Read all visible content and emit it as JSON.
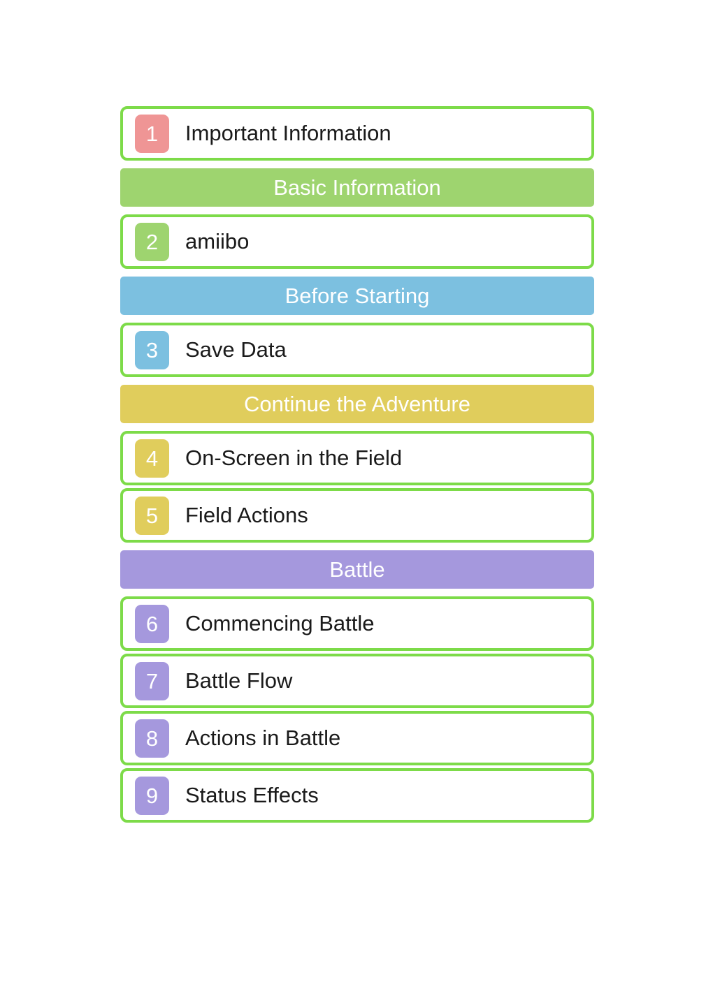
{
  "page": {
    "background_color": "#ffffff",
    "card_border_color": "#7ddb49",
    "card_background_color": "#ffffff",
    "title_text_color": "#1a1a1a",
    "header_text_color": "#ffffff"
  },
  "palette": {
    "important": "#ef9595",
    "basic": "#9ed46f",
    "before_starting": "#7cc0e0",
    "continue_adventure": "#e0cd5c",
    "battle": "#a598dd",
    "card_border": "#7ddb49"
  },
  "toc": {
    "entries": [
      {
        "kind": "chapter",
        "number": "1",
        "label": "Important Information",
        "badge_color": "#ef9595",
        "name": "toc-entry-important-information"
      },
      {
        "kind": "section",
        "label": "Basic Information",
        "bar_color": "#9ed46f",
        "name": "toc-section-basic-information"
      },
      {
        "kind": "chapter",
        "number": "2",
        "label": "amiibo",
        "badge_color": "#9ed46f",
        "name": "toc-entry-amiibo"
      },
      {
        "kind": "section",
        "label": "Before Starting",
        "bar_color": "#7cc0e0",
        "name": "toc-section-before-starting"
      },
      {
        "kind": "chapter",
        "number": "3",
        "label": "Save Data",
        "badge_color": "#7cc0e0",
        "name": "toc-entry-save-data"
      },
      {
        "kind": "section",
        "label": "Continue the Adventure",
        "bar_color": "#e0cd5c",
        "name": "toc-section-continue-the-adventure"
      },
      {
        "kind": "chapter",
        "number": "4",
        "label": "On-Screen in the Field",
        "badge_color": "#e0cd5c",
        "name": "toc-entry-on-screen-in-the-field"
      },
      {
        "kind": "chapter",
        "number": "5",
        "label": "Field Actions",
        "badge_color": "#e0cd5c",
        "name": "toc-entry-field-actions"
      },
      {
        "kind": "section",
        "label": "Battle",
        "bar_color": "#a598dd",
        "name": "toc-section-battle"
      },
      {
        "kind": "chapter",
        "number": "6",
        "label": "Commencing Battle",
        "badge_color": "#a598dd",
        "name": "toc-entry-commencing-battle"
      },
      {
        "kind": "chapter",
        "number": "7",
        "label": "Battle Flow",
        "badge_color": "#a598dd",
        "name": "toc-entry-battle-flow"
      },
      {
        "kind": "chapter",
        "number": "8",
        "label": "Actions in Battle",
        "badge_color": "#a598dd",
        "name": "toc-entry-actions-in-battle"
      },
      {
        "kind": "chapter",
        "number": "9",
        "label": "Status Effects",
        "badge_color": "#a598dd",
        "name": "toc-entry-status-effects"
      }
    ]
  }
}
